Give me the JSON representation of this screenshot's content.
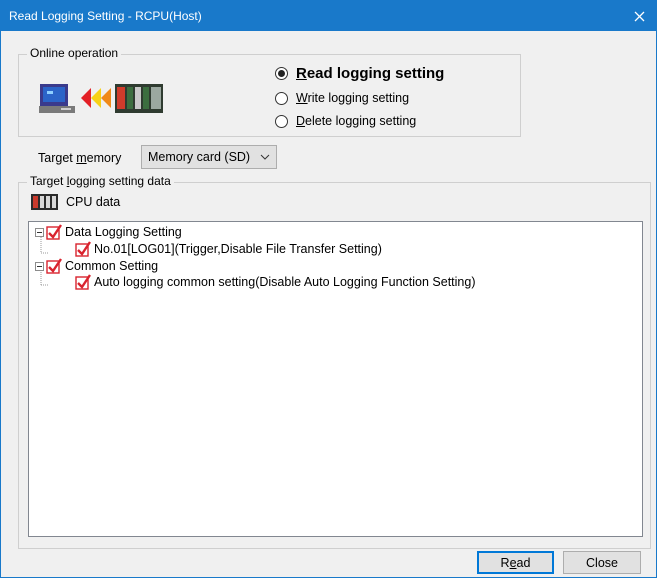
{
  "window": {
    "title": "Read Logging Setting - RCPU(Host)"
  },
  "online_operation": {
    "legend": "Online operation",
    "options": [
      {
        "prefix": "",
        "key": "R",
        "rest": "ead logging setting",
        "checked": true
      },
      {
        "prefix": "",
        "key": "W",
        "rest": "rite logging setting",
        "checked": false
      },
      {
        "prefix": "",
        "key": "D",
        "rest": "elete logging setting",
        "checked": false
      }
    ]
  },
  "target_memory": {
    "label_prefix": "Target ",
    "label_key": "m",
    "label_rest": "emory",
    "selected": "Memory card (SD)"
  },
  "target_data": {
    "legend_prefix": "Target ",
    "legend_key": "l",
    "legend_rest": "ogging setting data",
    "cpu_label": "CPU data"
  },
  "tree": {
    "data_logging": "Data Logging Setting",
    "log_item": "No.01[LOG01](Trigger,Disable File Transfer Setting)",
    "common_setting": "Common Setting",
    "common_item": "Auto logging common setting(Disable Auto Logging Function Setting)"
  },
  "buttons": {
    "read_prefix": "R",
    "read_key": "e",
    "read_rest": "ad",
    "close": "Close"
  },
  "colors": {
    "titlebar": "#1979ca",
    "check": "#d9232e"
  }
}
